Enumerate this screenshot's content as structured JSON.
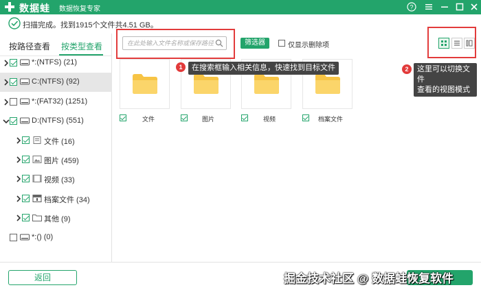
{
  "app": {
    "name": "数据蛙",
    "subtitle": "数据恢复专家",
    "brand_color": "#23a46b"
  },
  "window_controls": {
    "help": "?",
    "menu": "≡",
    "minimize": "−",
    "maximize": "□",
    "close": "✕"
  },
  "status": {
    "text": "扫描完成。找到1915个文件共4.51 GB。"
  },
  "tabs": {
    "by_path": "按路径查看",
    "by_type": "按类型查看",
    "active": "by_type"
  },
  "tree": [
    {
      "label": "*:(NTFS) (21)",
      "checked": true,
      "expandable": true,
      "level": 0,
      "icon": "drive-icon"
    },
    {
      "label": "C:(NTFS) (92)",
      "checked": true,
      "expandable": true,
      "level": 0,
      "icon": "drive-icon",
      "selected": true
    },
    {
      "label": "*:(FAT32) (1251)",
      "checked": false,
      "expandable": true,
      "level": 0,
      "icon": "drive-icon"
    },
    {
      "label": "D:(NTFS) (551)",
      "checked": true,
      "expandable": true,
      "expanded": true,
      "level": 0,
      "icon": "drive-icon"
    },
    {
      "label": "文件 (16)",
      "checked": true,
      "expandable": true,
      "level": 1,
      "icon": "document-icon"
    },
    {
      "label": "图片 (459)",
      "checked": true,
      "expandable": true,
      "level": 1,
      "icon": "image-icon"
    },
    {
      "label": "视频 (33)",
      "checked": true,
      "expandable": true,
      "level": 1,
      "icon": "video-icon"
    },
    {
      "label": "档案文件 (34)",
      "checked": true,
      "expandable": true,
      "level": 1,
      "icon": "archive-icon"
    },
    {
      "label": "其他 (9)",
      "checked": true,
      "expandable": true,
      "level": 1,
      "icon": "folder-icon"
    },
    {
      "label": "*:() (0)",
      "checked": false,
      "expandable": false,
      "level": 0,
      "icon": "drive-icon"
    }
  ],
  "toolbar": {
    "search_placeholder": "在此处输入文件名称或保存路径",
    "filter_label": "筛选器",
    "show_deleted_label": "仅显示删除项"
  },
  "tiles": [
    {
      "label": "文件",
      "checked": true
    },
    {
      "label": "图片",
      "checked": true
    },
    {
      "label": "视频",
      "checked": true
    },
    {
      "label": "档案文件",
      "checked": true
    }
  ],
  "tips": [
    {
      "number": "1",
      "text": "在搜索框输入相关信息，快速找到目标文件"
    },
    {
      "number": "2",
      "line1": "这里可以切换文件",
      "line2": "查看的视图模式"
    }
  ],
  "bottom": {
    "back_label": "返回",
    "watermark": "掘金技术社区 @ 数据蛙恢复软件"
  }
}
